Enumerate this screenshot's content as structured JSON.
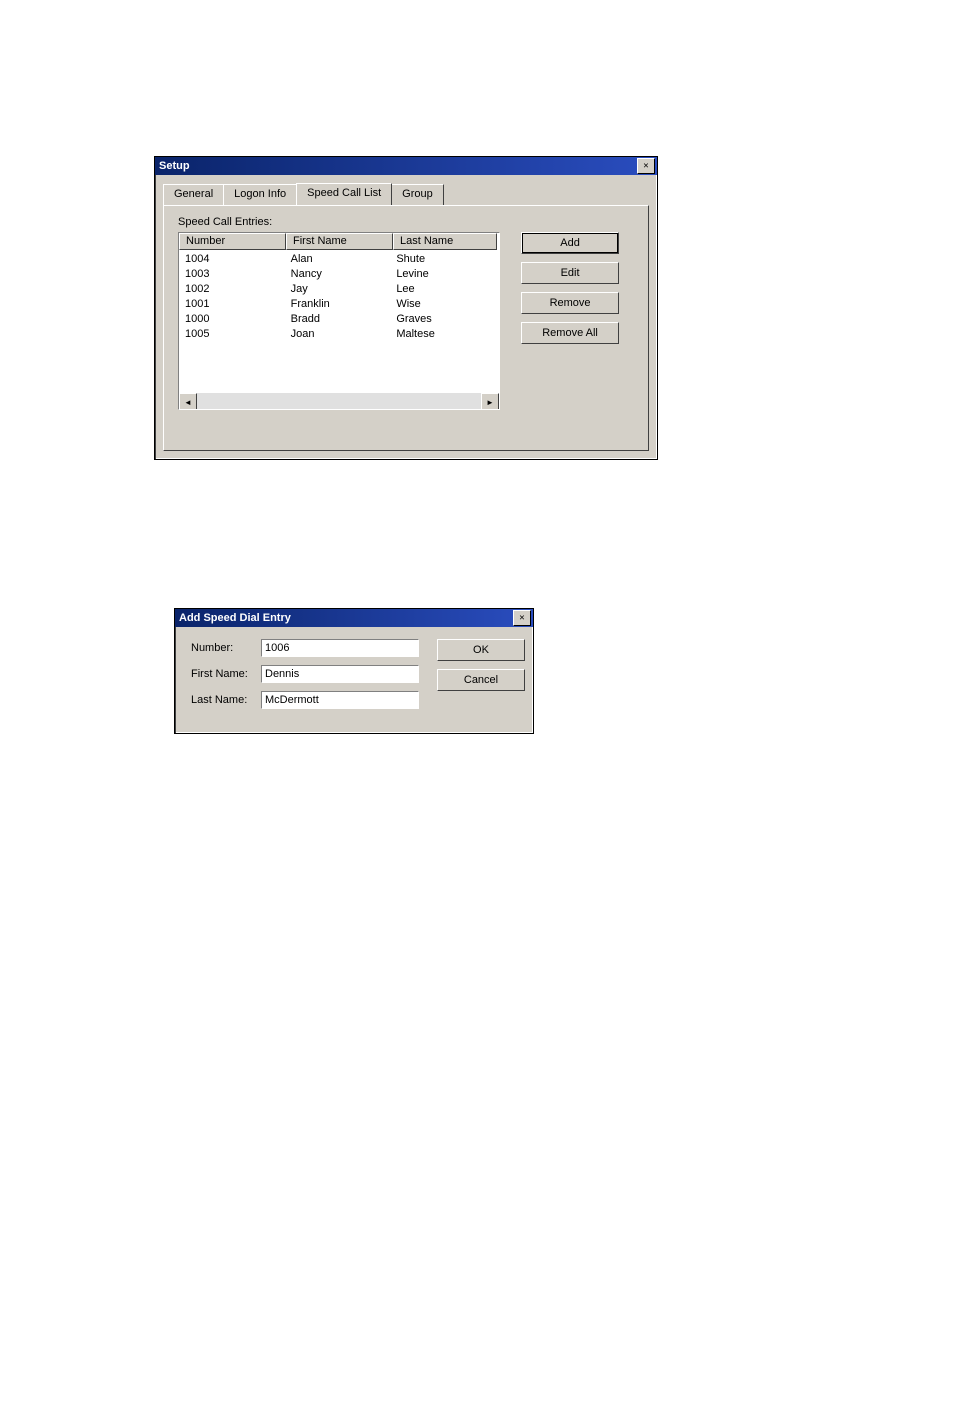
{
  "setup_window": {
    "title": "Setup",
    "tabs": [
      "General",
      "Logon Info",
      "Speed Call List",
      "Group"
    ],
    "active_tab_index": 2,
    "section_label": "Speed Call Entries:",
    "columns": [
      "Number",
      "First Name",
      "Last Name"
    ],
    "entries": [
      {
        "number": "1004",
        "first": "Alan",
        "last": "Shute"
      },
      {
        "number": "1003",
        "first": "Nancy",
        "last": "Levine"
      },
      {
        "number": "1002",
        "first": "Jay",
        "last": "Lee"
      },
      {
        "number": "1001",
        "first": "Franklin",
        "last": "Wise"
      },
      {
        "number": "1000",
        "first": "Bradd",
        "last": "Graves"
      },
      {
        "number": "1005",
        "first": "Joan",
        "last": "Maltese"
      }
    ],
    "buttons": {
      "add": "Add",
      "edit": "Edit",
      "remove": "Remove",
      "remove_all": "Remove All"
    },
    "scroll_left": "◄",
    "scroll_right": "►",
    "close_glyph": "✕"
  },
  "add_dialog": {
    "title": "Add Speed Dial Entry",
    "close_glyph": "✕",
    "labels": {
      "number": "Number:",
      "first": "First Name:",
      "last": "Last Name:"
    },
    "values": {
      "number": "1006",
      "first": "Dennis",
      "last": "McDermott"
    },
    "buttons": {
      "ok": "OK",
      "cancel": "Cancel"
    }
  }
}
